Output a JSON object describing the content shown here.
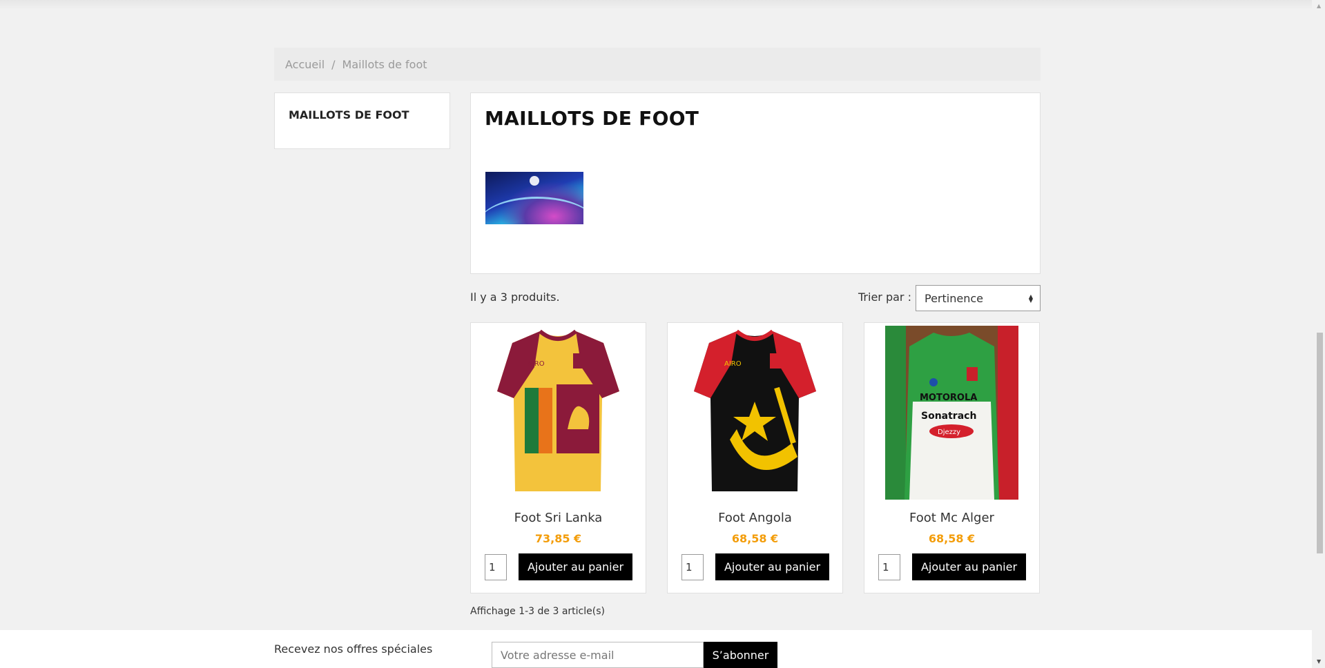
{
  "breadcrumb": {
    "home": "Accueil",
    "separator": "/",
    "current": "Maillots de foot"
  },
  "sidebar": {
    "title": "MAILLOTS DE FOOT"
  },
  "category": {
    "title": "MAILLOTS DE FOOT",
    "image_icon": "champions-league-banner"
  },
  "listing": {
    "count_text": "Il y a 3 produits.",
    "sort_label": "Trier par :",
    "sort_value": "Pertinence",
    "showing_text": "Affichage 1-3 de 3 article(s)"
  },
  "products": [
    {
      "name": "Foot Sri Lanka",
      "price": "73,85 €",
      "qty": "1",
      "button": "Ajouter au panier",
      "image_icon": "sri-lanka-jersey"
    },
    {
      "name": "Foot Angola",
      "price": "68,58 €",
      "qty": "1",
      "button": "Ajouter au panier",
      "image_icon": "angola-jersey"
    },
    {
      "name": "Foot Mc Alger",
      "price": "68,58 €",
      "qty": "1",
      "button": "Ajouter au panier",
      "image_icon": "mc-alger-jersey"
    }
  ],
  "newsletter": {
    "label": "Recevez nos offres spéciales",
    "placeholder": "Votre adresse e-mail",
    "button": "S’abonner"
  },
  "colors": {
    "price": "#f39d0a",
    "button_bg": "#000000",
    "page_bg": "#f1f1f1"
  }
}
